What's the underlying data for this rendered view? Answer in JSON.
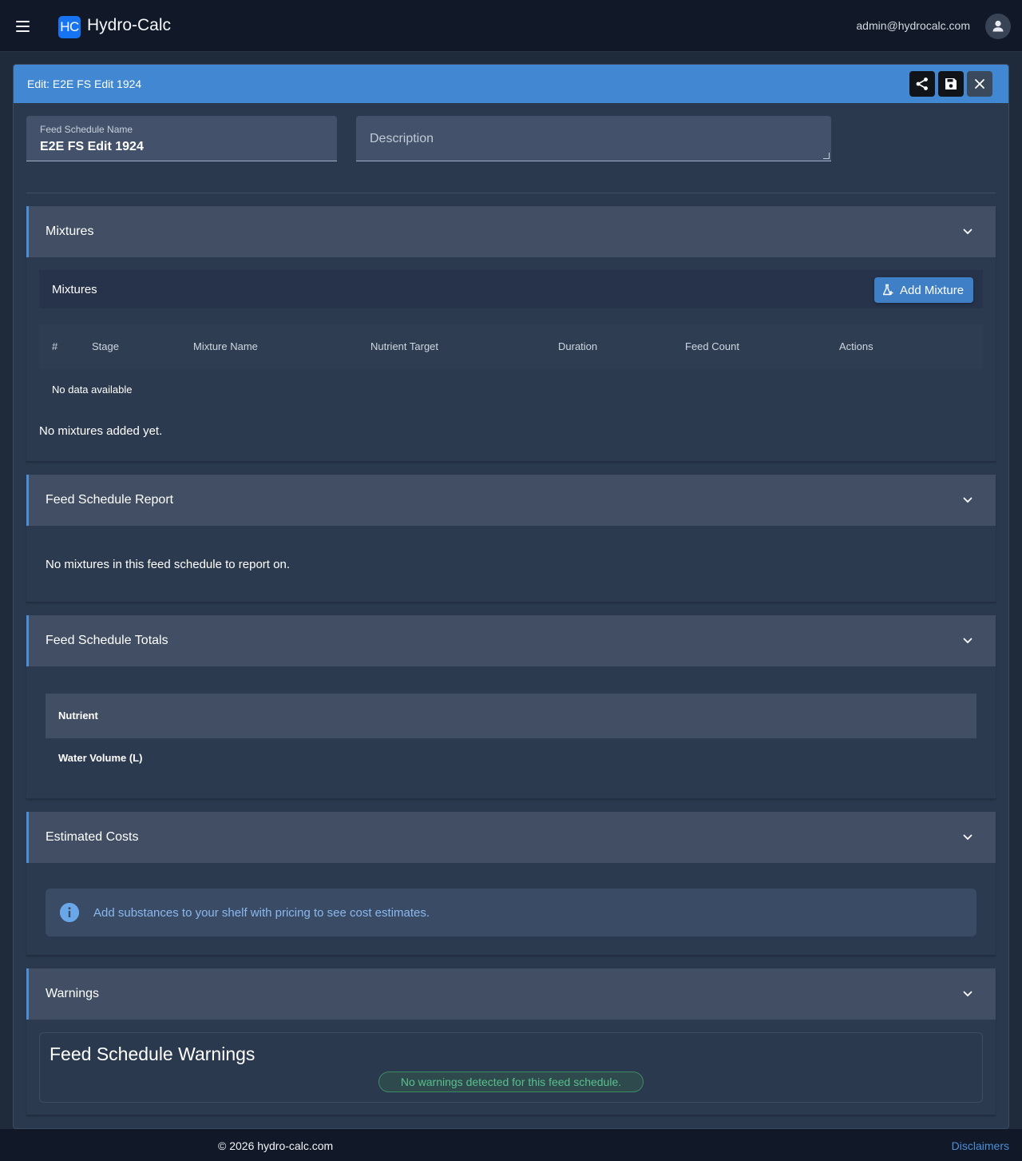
{
  "app": {
    "title": "Hydro-Calc",
    "logo_text": "HC",
    "user_email": "admin@hydrocalc.com"
  },
  "editor": {
    "title": "Edit: E2E FS Edit 1924",
    "actions": {
      "share_icon": "share-icon",
      "save_icon": "save-icon",
      "close_icon": "close-icon"
    }
  },
  "form": {
    "name_label": "Feed Schedule Name",
    "name_value": "E2E FS Edit 1924",
    "description_placeholder": "Description"
  },
  "mixtures": {
    "panel_title": "Mixtures",
    "toolbar_title": "Mixtures",
    "add_button": "Add Mixture",
    "columns": [
      "#",
      "Stage",
      "Mixture Name",
      "Nutrient Target",
      "Duration",
      "Feed Count",
      "Actions"
    ],
    "no_data": "No data available",
    "empty_message": "No mixtures added yet."
  },
  "report": {
    "panel_title": "Feed Schedule Report",
    "message": "No mixtures in this feed schedule to report on."
  },
  "totals": {
    "panel_title": "Feed Schedule Totals",
    "column": "Nutrient",
    "rows": [
      "Water Volume (L)"
    ]
  },
  "costs": {
    "panel_title": "Estimated Costs",
    "info": "Add substances to your shelf with pricing to see cost estimates."
  },
  "warnings": {
    "panel_title": "Warnings",
    "card_title": "Feed Schedule Warnings",
    "status": "No warnings detected for this feed schedule."
  },
  "footer": {
    "copyright": "© 2026 hydro-calc.com",
    "disclaimers": "Disclaimers"
  },
  "colors": {
    "accent": "#4187d1",
    "background": "#1f2a3b",
    "success": "#58c08d"
  }
}
